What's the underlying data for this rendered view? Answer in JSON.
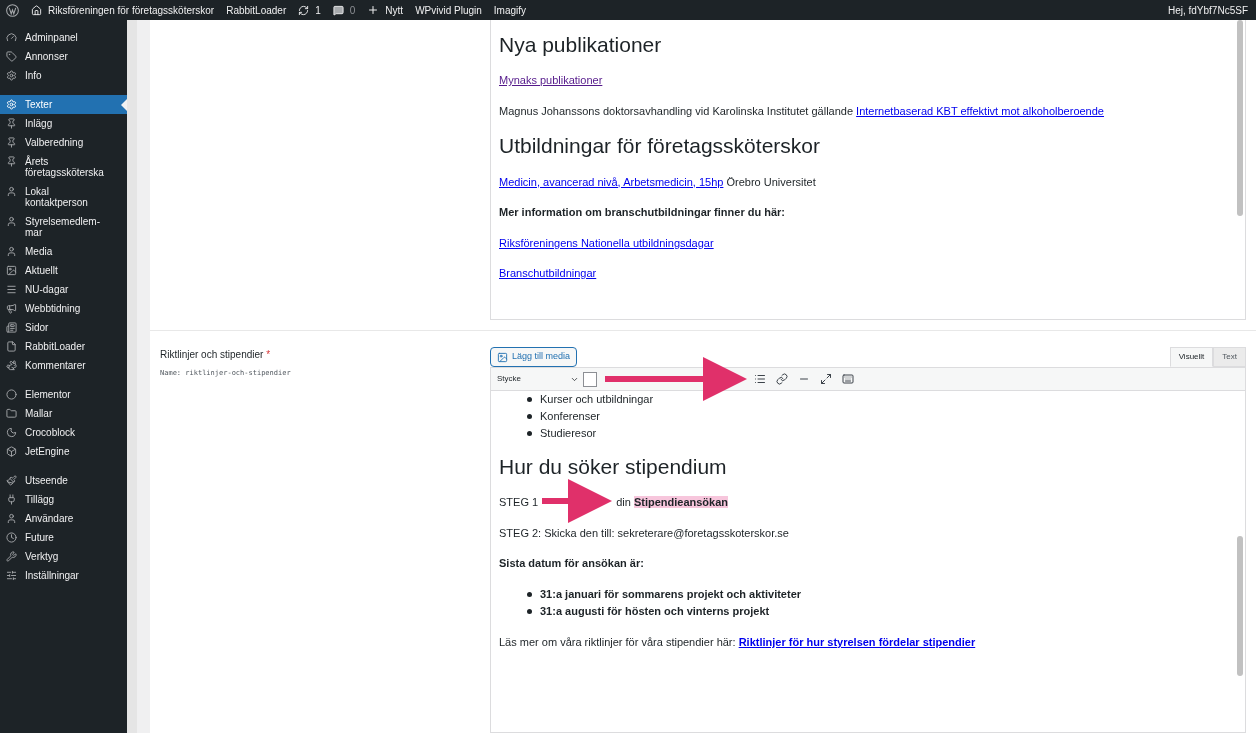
{
  "admin_bar": {
    "items": [
      {
        "kind": "site",
        "label": "Riksföreningen för företagssköterskor"
      },
      {
        "kind": "text",
        "label": "RabbitLoader"
      },
      {
        "kind": "updates",
        "label": "1"
      },
      {
        "kind": "comments",
        "label": "0"
      },
      {
        "kind": "new",
        "label": "Nytt"
      },
      {
        "kind": "text",
        "label": "WPvivid Plugin"
      },
      {
        "kind": "text",
        "label": "Imagify"
      }
    ],
    "greeting": "Hej, fdYbf7Nc5SF"
  },
  "sidebar": {
    "groups": [
      [
        {
          "label": "Adminpanel",
          "selected": false
        },
        {
          "label": "Annonser",
          "selected": false
        },
        {
          "label": "Info",
          "selected": false
        }
      ],
      [
        {
          "label": "Texter",
          "selected": true
        },
        {
          "label": "Inlägg",
          "selected": false
        },
        {
          "label": "Valberedning",
          "selected": false
        },
        {
          "label": "Årets företagssköterska",
          "selected": false
        },
        {
          "label": "Lokal kontaktperson",
          "selected": false
        },
        {
          "label": "Styrelsemedlem-mar",
          "selected": false
        },
        {
          "label": "Media",
          "selected": false
        },
        {
          "label": "Aktuellt",
          "selected": false
        },
        {
          "label": "NU-dagar",
          "selected": false
        },
        {
          "label": "Webbtidning",
          "selected": false
        },
        {
          "label": "Sidor",
          "selected": false
        },
        {
          "label": "RabbitLoader",
          "selected": false
        },
        {
          "label": "Kommentarer",
          "selected": false
        }
      ],
      [
        {
          "label": "Elementor",
          "selected": false
        },
        {
          "label": "Mallar",
          "selected": false
        },
        {
          "label": "Crocoblock",
          "selected": false
        },
        {
          "label": "JetEngine",
          "selected": false
        }
      ],
      [
        {
          "label": "Utseende",
          "selected": false
        },
        {
          "label": "Tillägg",
          "selected": false
        },
        {
          "label": "Användare",
          "selected": false
        },
        {
          "label": "Future",
          "selected": false
        },
        {
          "label": "Verktyg",
          "selected": false
        },
        {
          "label": "Inställningar",
          "selected": false
        }
      ]
    ]
  },
  "fields": [
    {
      "editor": {
        "blocks": [
          {
            "kind": "h2",
            "text": "Nya publikationer"
          },
          {
            "kind": "p",
            "parts": [
              {
                "kind": "visited_link",
                "text": "Mynaks publikationer"
              }
            ]
          },
          {
            "kind": "p",
            "parts": [
              {
                "kind": "text",
                "text": "Magnus Johanssons doktorsavhandling vid Karolinska Institutet gällande "
              },
              {
                "kind": "link",
                "text": "Internetbaserad KBT effektivt mot alkoholberoende "
              }
            ]
          },
          {
            "kind": "h2",
            "text": "Utbildningar för företagssköterskor"
          },
          {
            "kind": "p",
            "parts": [
              {
                "kind": "link",
                "text": "Medicin, avancerad nivå, Arbetsmedicin, 15hp"
              },
              {
                "kind": "text",
                "text": " Örebro Universitet"
              }
            ]
          },
          {
            "kind": "p",
            "parts": [
              {
                "kind": "strong",
                "text": "Mer information om branschutbildningar finner du här:"
              }
            ]
          },
          {
            "kind": "p",
            "parts": [
              {
                "kind": "link",
                "text": "Riksföreningens Nationella utbildningsdagar"
              }
            ]
          },
          {
            "kind": "p",
            "parts": [
              {
                "kind": "link",
                "text": "Branschutbildningar"
              }
            ]
          }
        ]
      }
    },
    {
      "label": "Riktlinjer och stipendier",
      "required_mark": "*",
      "name_hint": "Name: riktlinjer-och-stipendier",
      "media_button": "Lägg till media",
      "tabs": [
        {
          "label": "Visuellt",
          "selected": true
        },
        {
          "label": "Text",
          "selected": false
        }
      ],
      "format_select": "Stycke",
      "editor": {
        "blocks": [
          {
            "kind": "ul",
            "bold": false,
            "items": [
              "Kurser och utbildningar",
              "Konferenser",
              "Studieresor"
            ]
          },
          {
            "kind": "h2",
            "text": "Hur du söker stipendium"
          },
          {
            "kind": "p",
            "parts": [
              {
                "kind": "text",
                "text": "STEG 1"
              },
              {
                "kind": "arrow"
              },
              {
                "kind": "text",
                "text": "din "
              },
              {
                "kind": "highlight",
                "text": "Stipendieansökan"
              }
            ]
          },
          {
            "kind": "p",
            "parts": [
              {
                "kind": "text",
                "text": "STEG 2: Skicka den till: sekreterare@foretagsskoterskor.se"
              }
            ]
          },
          {
            "kind": "p",
            "parts": [
              {
                "kind": "strong",
                "text": "Sista datum för ansökan är:"
              }
            ]
          },
          {
            "kind": "ul",
            "bold": true,
            "items": [
              "31:a januari för sommarens projekt och aktiviteter",
              "31:a augusti för hösten och vinterns projekt"
            ]
          },
          {
            "kind": "p",
            "parts": [
              {
                "kind": "text",
                "text": "Läs mer om våra riktlinjer för våra stipendier här: "
              },
              {
                "kind": "strong_link",
                "text": "Riktlinjer för hur styrelsen fördelar stipendier"
              }
            ]
          }
        ]
      }
    }
  ]
}
